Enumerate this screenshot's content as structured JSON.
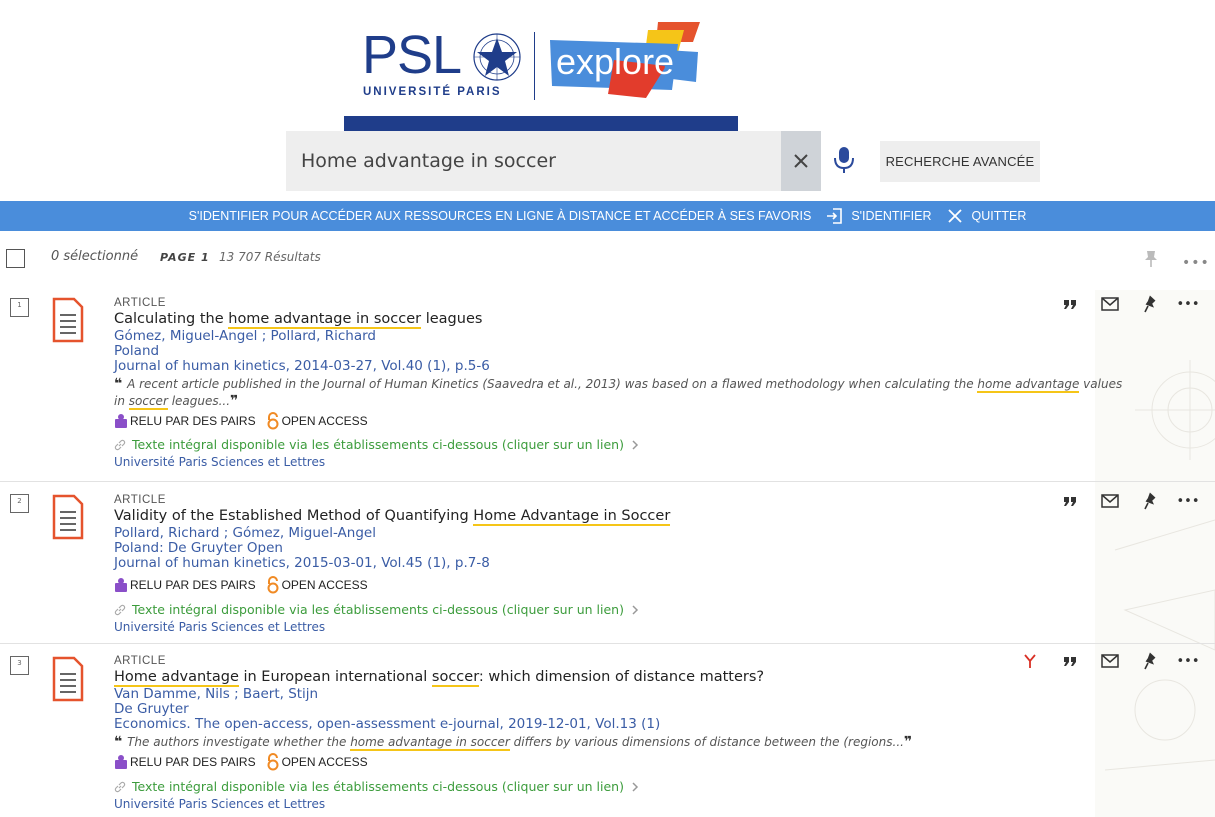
{
  "header": {
    "psl_logo_text": "PSL",
    "psl_logo_subtitle": "UNIVERSITÉ PARIS",
    "explore_logo_text": "explore"
  },
  "search": {
    "value": "Home advantage in soccer",
    "advanced_label": "RECHERCHE AVANCÉE"
  },
  "banner": {
    "message": "S'IDENTIFIER POUR ACCÉDER AUX RESSOURCES EN LIGNE À DISTANCE ET ACCÉDER À SES FAVORIS",
    "login_label": "S'IDENTIFIER",
    "quit_label": "QUITTER"
  },
  "results_header": {
    "selected": "0 sélectionné",
    "page": "PAGE 1",
    "count": "13 707 Résultats"
  },
  "results": [
    {
      "num": "1",
      "type": "ARTICLE",
      "title_pre": "Calculating the ",
      "title_hl": "home advantage in soccer",
      "title_post": " leagues",
      "authors": "Gómez, Miguel-Angel ; Pollard, Richard",
      "publisher": "Poland",
      "source": "Journal of human kinetics, 2014-03-27, Vol.40 (1), p.5-6",
      "snippet_pre": "A recent article published in the Journal of Human Kinetics (Saavedra et al., 2013) was based on a flawed methodology when calculating the ",
      "snippet_hl1": "home advantage",
      "snippet_mid": " values in ",
      "snippet_hl2": "soccer",
      "snippet_post": " leagues...",
      "peer": "RELU PAR DES PAIRS",
      "oa": "OPEN ACCESS",
      "avail": "Texte intégral disponible via les établissements ci-dessous (cliquer sur un lien)",
      "institution": "Université Paris Sciences et Lettres"
    },
    {
      "num": "2",
      "type": "ARTICLE",
      "title_pre": "Validity of the Established Method of Quantifying ",
      "title_hl": "Home Advantage in Soccer",
      "title_post": "",
      "authors": "Pollard, Richard ; Gómez, Miguel-Angel",
      "publisher": "Poland: De Gruyter Open",
      "source": "Journal of human kinetics, 2015-03-01, Vol.45 (1), p.7-8",
      "peer": "RELU PAR DES PAIRS",
      "oa": "OPEN ACCESS",
      "avail": "Texte intégral disponible via les établissements ci-dessous (cliquer sur un lien)",
      "institution": "Université Paris Sciences et Lettres"
    },
    {
      "num": "3",
      "type": "ARTICLE",
      "title_hl1": "Home advantage",
      "title_mid": " in European international ",
      "title_hl2": "soccer",
      "title_post": ": which dimension of distance matters?",
      "authors": "Van Damme, Nils ; Baert, Stijn",
      "publisher": "De Gruyter",
      "source": "Economics. The open-access, open-assessment e-journal, 2019-12-01, Vol.13 (1)",
      "snippet_pre": "The authors investigate whether the ",
      "snippet_hl": "home advantage in soccer",
      "snippet_post": " differs by various dimensions of distance between the (regions...",
      "peer": "RELU PAR DES PAIRS",
      "oa": "OPEN ACCESS",
      "avail": "Texte intégral disponible via les établissements ci-dessous (cliquer sur un lien)",
      "institution": "Université Paris Sciences et Lettres"
    }
  ],
  "colors": {
    "brand_blue": "#1f3d8a",
    "banner_blue": "#4a8ddb",
    "highlight": "#f5c518",
    "link_blue": "#3a5ca5",
    "avail_green": "#3c9c3c",
    "doc_icon_orange": "#e5532d",
    "peer_purple": "#8a4fc8",
    "oa_orange": "#f08a24"
  },
  "icons": [
    "star-icon",
    "close-icon",
    "microphone-icon",
    "login-icon",
    "pin-icon",
    "more-icon",
    "document-icon",
    "quote-icon",
    "email-icon",
    "peer-review-icon",
    "open-lock-icon",
    "link-icon",
    "chevron-right-icon",
    "citation-trail-icon"
  ]
}
